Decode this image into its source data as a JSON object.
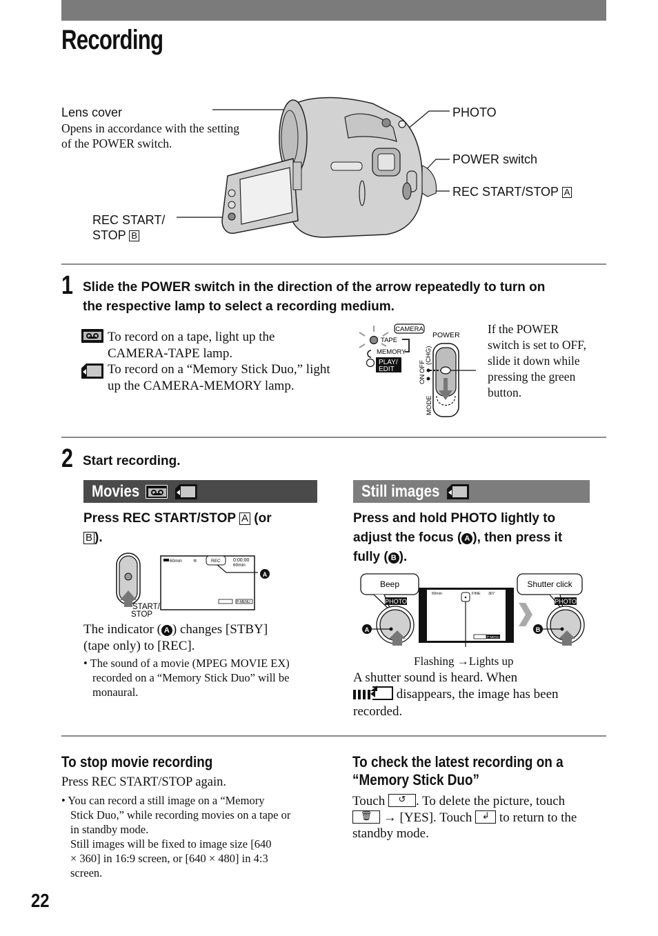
{
  "page": {
    "title": "Recording",
    "page_number": "22"
  },
  "figure_camera": {
    "callouts": {
      "lens_cover": {
        "label": "Lens cover",
        "description_line1": "Opens in accordance with the setting",
        "description_line2": "of the POWER switch."
      },
      "rec_start_stop_b": {
        "line1": "REC START/",
        "line2": "STOP",
        "marker": "B"
      },
      "photo": "PHOTO",
      "power_switch": "POWER switch",
      "rec_start_stop_a": {
        "label": "REC START/STOP",
        "marker": "A"
      }
    }
  },
  "step1": {
    "number": "1",
    "heading_line1": "Slide the POWER switch in the direction of the arrow repeatedly to turn on",
    "heading_line2": "the respective lamp to select a recording medium.",
    "tape": {
      "icon": "tape-icon",
      "line1": "To record on a tape, light up the",
      "line2": "CAMERA-TAPE lamp."
    },
    "memory": {
      "icon": "memory-stick-icon",
      "line1": "To record on a “Memory Stick Duo,” light",
      "line2": "up the CAMERA-MEMORY lamp."
    },
    "switch_diagram": {
      "camera": "CAMERA",
      "tape": "TAPE",
      "memory": "MEMORY",
      "play": "PLAY/",
      "edit": "EDIT",
      "power": "POWER",
      "chg": "(CHG)",
      "on": "ON",
      "off": "OFF",
      "mode": "MODE"
    },
    "note_lines": [
      "If the POWER",
      "switch is set to OFF,",
      "slide it down while",
      "pressing the green",
      "button."
    ]
  },
  "step2": {
    "number": "2",
    "heading": "Start recording.",
    "movies": {
      "band_label": "Movies",
      "instruction_part1": "Press REC START/STOP",
      "marker_a": "A",
      "instruction_part2": "(or",
      "marker_b": "B",
      "instruction_part3": ").",
      "button_label_line1": "START/",
      "button_label_line2": "STOP",
      "screen": {
        "remaining": "60min",
        "counter": "0:00:00",
        "remaining2": "60min",
        "status": "REC",
        "menu": "P-MENU",
        "callout": "A"
      },
      "result_part1": "The indicator (",
      "result_marker": "A",
      "result_part2": ") changes [STBY]",
      "result_line2": "(tape only) to [REC].",
      "note_lines": [
        "The sound of a movie (MPEG MOVIE EX)",
        "recorded on a “Memory Stick Duo” will be",
        "monaural."
      ]
    },
    "still": {
      "band_label": "Still images",
      "instruction_line1": "Press and hold PHOTO lightly to",
      "instruction_line2_part1": "adjust the focus (",
      "marker_a": "A",
      "instruction_line2_part2": "), then press it",
      "instruction_line3_part1": "fully (",
      "marker_b": "B",
      "instruction_line3_part2": ").",
      "bubble_left": "Beep",
      "bubble_right": "Shutter click",
      "photo_label": "PHOTO",
      "screen": {
        "remaining": "60min",
        "quality": "FINE",
        "count": "307",
        "menu": "P-MENU"
      },
      "caption": "Flashing →Lights up",
      "result_line1": "A shutter sound is heard. When",
      "result_line2": "disappears, the image has been",
      "result_line3": "recorded."
    }
  },
  "stop_section": {
    "heading": "To stop movie recording",
    "body": "Press REC START/STOP again.",
    "note_lines": [
      "You can record a still image on a “Memory",
      "Stick Duo,” while recording movies on a tape or",
      "in standby mode.",
      "Still images will be fixed to image size [640",
      "× 360] in 16:9 screen, or [640 × 480] in 4:3",
      "screen."
    ]
  },
  "check_section": {
    "heading_line1": "To check the latest recording on a",
    "heading_line2": "“Memory Stick Duo”",
    "line1_part1": "Touch",
    "line1_part2": ". To delete the picture, touch",
    "line2_part1": "→ [YES]. Touch",
    "line2_part2": "to return to the",
    "line3": "standby mode.",
    "icons": {
      "review": "↺",
      "delete": "🗑",
      "return": "↲"
    }
  }
}
